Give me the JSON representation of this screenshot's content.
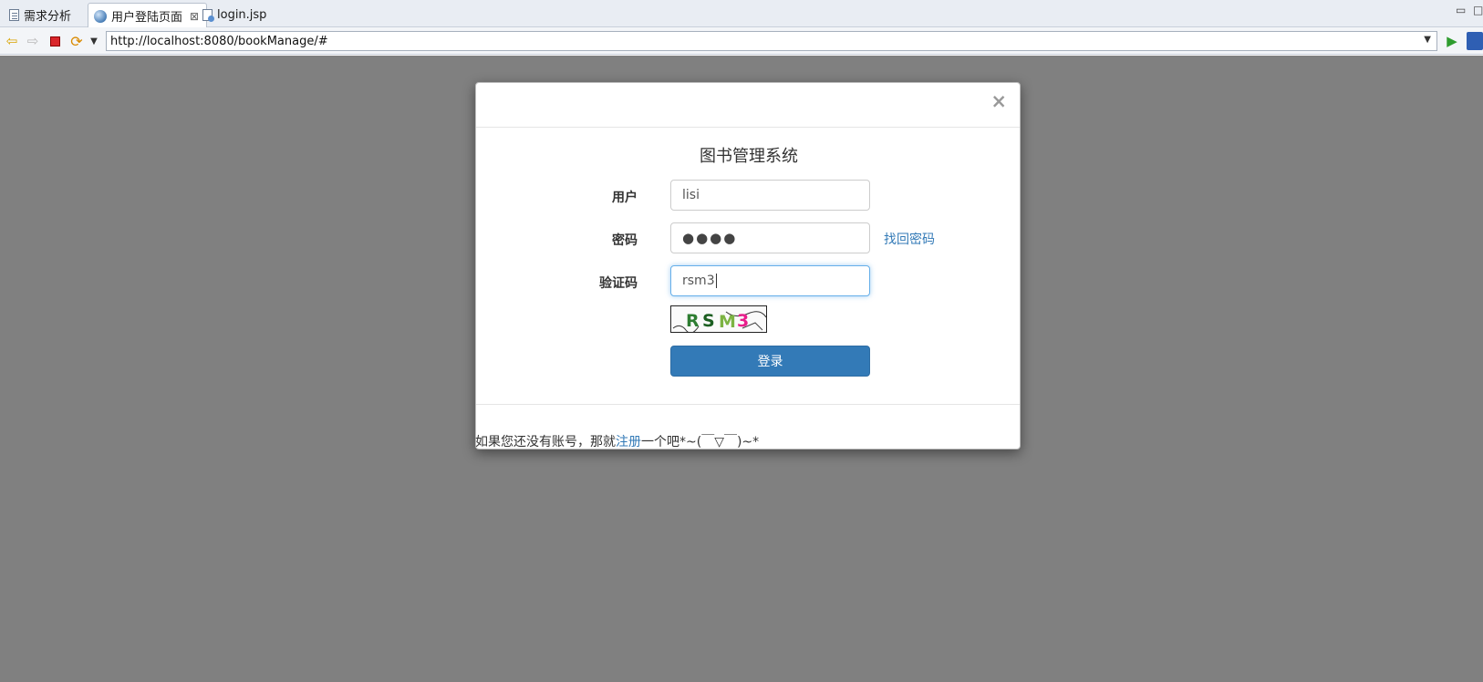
{
  "tabs": [
    {
      "label": "需求分析",
      "icon": "document-icon"
    },
    {
      "label": "用户登陆页面",
      "icon": "globe-icon",
      "active": true,
      "close": "⊠"
    },
    {
      "label": "login.jsp",
      "icon": "jsp-file-icon"
    }
  ],
  "address": {
    "url": "http://localhost:8080/bookManage/#"
  },
  "modal": {
    "close_symbol": "×",
    "title": "图书管理系统",
    "fields": {
      "username_label": "用户",
      "username_value": "lisi",
      "password_label": "密码",
      "password_value": "●●●●",
      "captcha_label": "验证码",
      "captcha_value": "rsm3"
    },
    "captcha_image_text": "RSM3",
    "forgot_link": "找回密码",
    "login_button": "登录",
    "footer": {
      "prefix": "如果您还没有账号，那就",
      "link": "注册",
      "suffix": "一个吧*~(￣▽￣)~*"
    }
  },
  "colors": {
    "overlay": "#808080",
    "primary": "#337ab7",
    "link": "#337ab7"
  }
}
